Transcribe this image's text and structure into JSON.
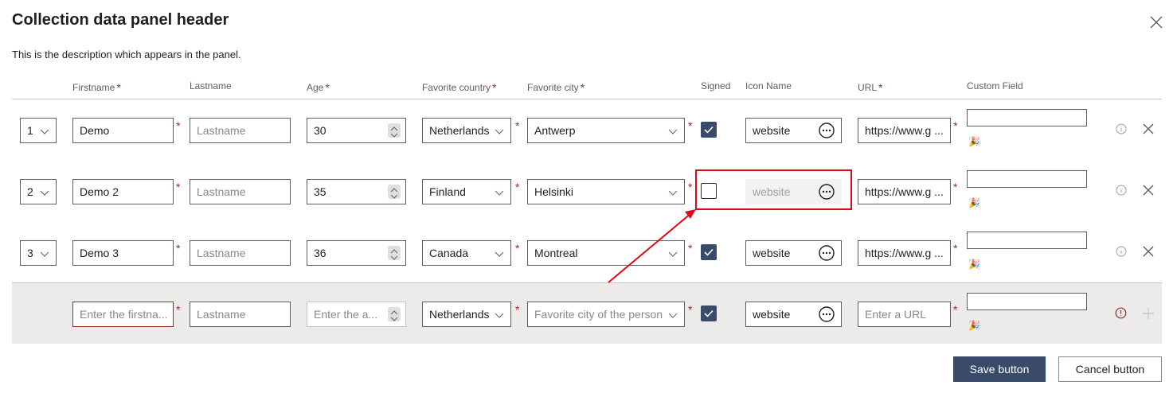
{
  "panel": {
    "title": "Collection data panel header",
    "description": "This is the description which appears in the panel."
  },
  "columns": {
    "firstname": "Firstname",
    "lastname": "Lastname",
    "age": "Age",
    "country": "Favorite country",
    "city": "Favorite city",
    "signed": "Signed",
    "icon_name": "Icon Name",
    "url": "URL",
    "custom": "Custom Field",
    "required_mark": "*"
  },
  "rows": [
    {
      "order": "1",
      "firstname": "Demo",
      "lastname_placeholder": "Lastname",
      "age": "30",
      "country": "Netherlands",
      "city": "Antwerp",
      "signed": true,
      "icon_name": "website",
      "url": "https://www.g ..."
    },
    {
      "order": "2",
      "firstname": "Demo 2",
      "lastname_placeholder": "Lastname",
      "age": "35",
      "country": "Finland",
      "city": "Helsinki",
      "signed": false,
      "icon_name": "website",
      "url": "https://www.g ..."
    },
    {
      "order": "3",
      "firstname": "Demo 3",
      "lastname_placeholder": "Lastname",
      "age": "36",
      "country": "Canada",
      "city": "Montreal",
      "signed": true,
      "icon_name": "website",
      "url": "https://www.g ..."
    }
  ],
  "new_row": {
    "firstname_placeholder": "Enter the firstna...",
    "lastname_placeholder": "Lastname",
    "age_placeholder": "Enter the a...",
    "country": "Netherlands",
    "city_placeholder": "Favorite city of the person",
    "signed": true,
    "icon_name": "website",
    "url_placeholder": "Enter a URL"
  },
  "footer": {
    "save_label": "Save button",
    "cancel_label": "Cancel button"
  },
  "colors": {
    "primary": "#3a4a6b",
    "required": "#a4262c",
    "highlight": "#e30613"
  }
}
